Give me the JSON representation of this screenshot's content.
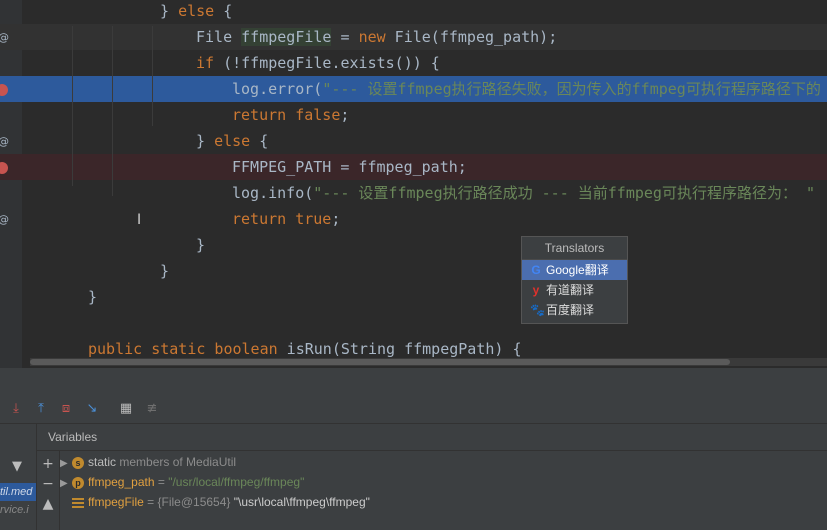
{
  "editor": {
    "lines": [
      {
        "indent": 4,
        "parts": [
          [
            "p",
            "} "
          ],
          [
            "k",
            "else"
          ],
          [
            "p",
            " {"
          ]
        ]
      },
      {
        "indent": 5,
        "parts": [
          [
            "p",
            "File "
          ],
          [
            "hv",
            "ffmpegFile"
          ],
          [
            "p",
            " = "
          ],
          [
            "k",
            "new"
          ],
          [
            "p",
            " File(ffmpeg_path);"
          ]
        ]
      },
      {
        "indent": 5,
        "parts": [
          [
            "k",
            "if"
          ],
          [
            "p",
            " (!ffmpegFile.exists()) {"
          ]
        ]
      },
      {
        "indent": 6,
        "parts": [
          [
            "p",
            "log.error("
          ],
          [
            "s",
            "\"--- 设置ffmpeg执行路径失败，因为传入的ffmpeg可执行程序路径下的"
          ]
        ]
      },
      {
        "indent": 6,
        "parts": [
          [
            "k",
            "return false"
          ],
          [
            "p",
            ";"
          ]
        ]
      },
      {
        "indent": 5,
        "parts": [
          [
            "p",
            "} "
          ],
          [
            "k",
            "else"
          ],
          [
            "p",
            " {"
          ]
        ]
      },
      {
        "indent": 6,
        "parts": [
          [
            "p",
            "FFMPEG_PATH = ffmpeg_path;"
          ]
        ]
      },
      {
        "indent": 6,
        "parts": [
          [
            "p",
            "log.info("
          ],
          [
            "s",
            "\"--- 设置ffmpeg执行路径成功 --- 当前ffmpeg可执行程序路径为： \""
          ]
        ]
      },
      {
        "indent": 6,
        "parts": [
          [
            "k",
            "return true"
          ],
          [
            "p",
            ";"
          ]
        ]
      },
      {
        "indent": 5,
        "parts": [
          [
            "p",
            "}"
          ]
        ]
      },
      {
        "indent": 4,
        "parts": [
          [
            "p",
            "}"
          ]
        ]
      },
      {
        "indent": 2,
        "parts": [
          [
            "p",
            "}"
          ]
        ]
      },
      {
        "indent": 2,
        "parts": [
          [
            "p",
            ""
          ]
        ]
      },
      {
        "indent": 2,
        "parts": [
          [
            "k",
            "public static boolean"
          ],
          [
            "p",
            " isRun(String ffmpegPath) {"
          ]
        ]
      }
    ]
  },
  "translators_popup": {
    "title": "Translators",
    "items": [
      {
        "icon": "google-icon",
        "glyph": "G",
        "label": "Google翻译",
        "color": "#4285f4"
      },
      {
        "icon": "youdao-icon",
        "glyph": "y",
        "label": "有道翻译",
        "color": "#e0312c"
      },
      {
        "icon": "baidu-icon",
        "glyph": "🐾",
        "label": "百度翻译",
        "color": "#ffffff"
      }
    ]
  },
  "debug": {
    "variables_title": "Variables",
    "frames": {
      "selected": "til.med",
      "next": "rvice.i"
    },
    "variables": [
      {
        "expand": "▶",
        "icon": "static-icon",
        "badge": "s",
        "name": "static",
        "value": "members of MediaUtil"
      },
      {
        "expand": "▶",
        "icon": "parameter-icon",
        "badge": "p",
        "name": "ffmpeg_path",
        "eq": " = ",
        "value": "\"/usr/local/ffmpeg/ffmpeg\""
      },
      {
        "expand": "",
        "icon": "field-icon",
        "badge": "",
        "name": "ffmpegFile",
        "eq": " = ",
        "ref": "{File@15654}",
        "value": " \"\\usr\\local\\ffmpeg\\ffmpeg\""
      }
    ]
  },
  "colors": {
    "exec_line": "#2d5a9c",
    "breakpoint": "#c75450",
    "keyword": "#cc7832",
    "string": "#6a8759"
  }
}
